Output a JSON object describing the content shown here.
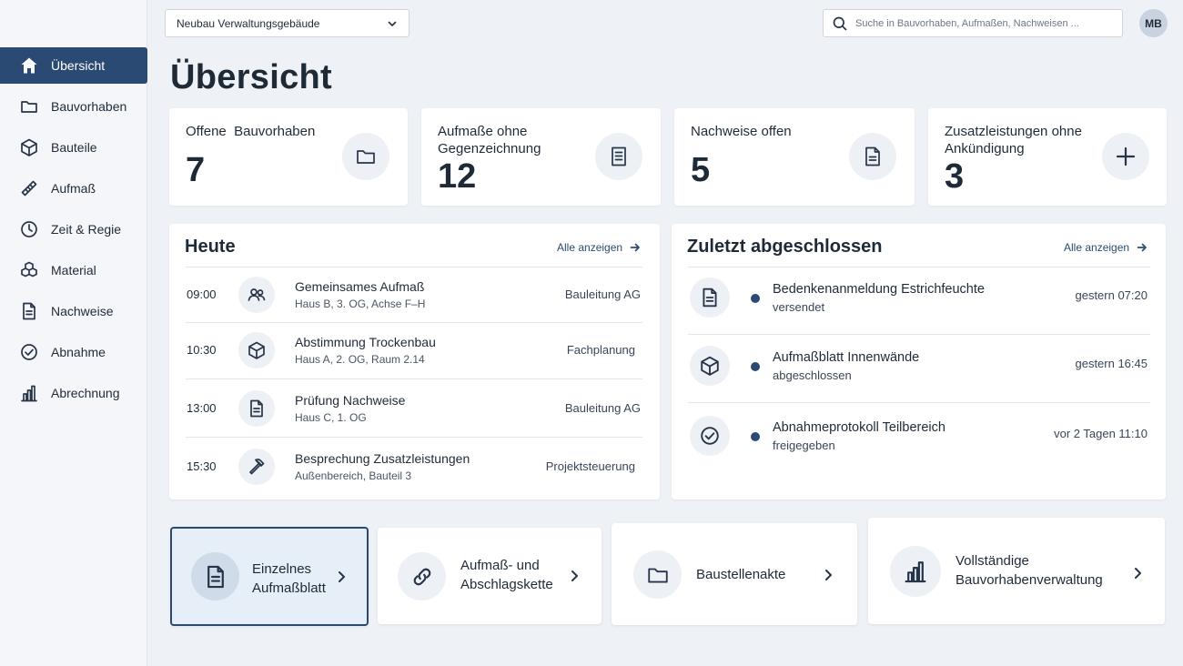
{
  "topbar": {
    "project": "Neubau Verwaltungsgebäude",
    "search_placeholder": "Suche in Bauvorhaben, Aufmaßen, Nachweisen ...",
    "user_initials": "MB"
  },
  "sidebar": {
    "items": [
      {
        "label": "Übersicht",
        "icon": "home-icon",
        "active": true
      },
      {
        "label": "Bauvorhaben",
        "icon": "folder-icon"
      },
      {
        "label": "Bauteile",
        "icon": "cube-icon"
      },
      {
        "label": "Aufmaß",
        "icon": "ruler-icon"
      },
      {
        "label": "Zeit & Regie",
        "icon": "clock-icon"
      },
      {
        "label": "Material",
        "icon": "boxes-icon"
      },
      {
        "label": "Nachweise",
        "icon": "document-icon"
      },
      {
        "label": "Abnahme",
        "icon": "check-circle-icon"
      },
      {
        "label": "Abrechnung",
        "icon": "bar-chart-icon"
      }
    ]
  },
  "page": {
    "title": "Übersicht"
  },
  "stats": [
    {
      "label": "Offene  Bauvorhaben",
      "value": "7",
      "icon": "folder-icon"
    },
    {
      "label": "Aufmaße ohne Gegenzeichnung",
      "value": "12",
      "icon": "document-lines-icon"
    },
    {
      "label": "Nachweise offen",
      "value": "5",
      "icon": "document-icon"
    },
    {
      "label": "Zusatzleistungen ohne Ankündigung",
      "value": "3",
      "icon": "plus-icon"
    }
  ],
  "today": {
    "title": "Heute",
    "show_all": "Alle anzeigen",
    "items": [
      {
        "time": "09:00",
        "title": "Gemeinsames Aufmaß",
        "sub": "Haus B, 3. OG, Achse F–H",
        "role": "Bauleitung AG",
        "icon": "people-icon"
      },
      {
        "time": "10:30",
        "title": "Abstimmung Trockenbau",
        "sub": "Haus A, 2. OG, Raum 2.14",
        "role": "Fachplanung",
        "icon": "cube-icon"
      },
      {
        "time": "13:00",
        "title": "Prüfung Nachweise",
        "sub": "Haus C, 1. OG",
        "role": "Bauleitung AG",
        "icon": "document-icon"
      },
      {
        "time": "15:30",
        "title": "Besprechung Zusatzleistungen",
        "sub": "Außenbereich, Bauteil 3",
        "role": "Projektsteuerung",
        "icon": "hammer-icon"
      }
    ]
  },
  "recent": {
    "title": "Zuletzt abgeschlossen",
    "show_all": "Alle anzeigen",
    "items": [
      {
        "title": "Bedenkenanmeldung Estrichfeuchte",
        "status": "versendet",
        "time": "gestern 07:20",
        "icon": "document-icon"
      },
      {
        "title": "Aufmaßblatt Innenwände",
        "status": "abgeschlossen",
        "time": "gestern 16:45",
        "icon": "cube-icon"
      },
      {
        "title": "Abnahmeprotokoll Teilbereich",
        "status": "freigegeben",
        "time": "vor 2 Tagen 11:10",
        "icon": "check-circle-icon"
      }
    ]
  },
  "quick_actions": [
    {
      "label": "Einzelnes Aufmaßblatt",
      "icon": "document-icon",
      "selected": true
    },
    {
      "label": "Aufmaß- und Abschlagskette",
      "icon": "link-icon"
    },
    {
      "label": "Baustellenakte",
      "icon": "folder-icon"
    },
    {
      "label": "Vollständige Bauvorhabenverwaltung",
      "icon": "bar-chart-icon"
    }
  ],
  "colors": {
    "accent": "#2b4a73",
    "background": "#eef1f5",
    "card": "#ffffff",
    "icon_circle": "#edf0f4"
  }
}
